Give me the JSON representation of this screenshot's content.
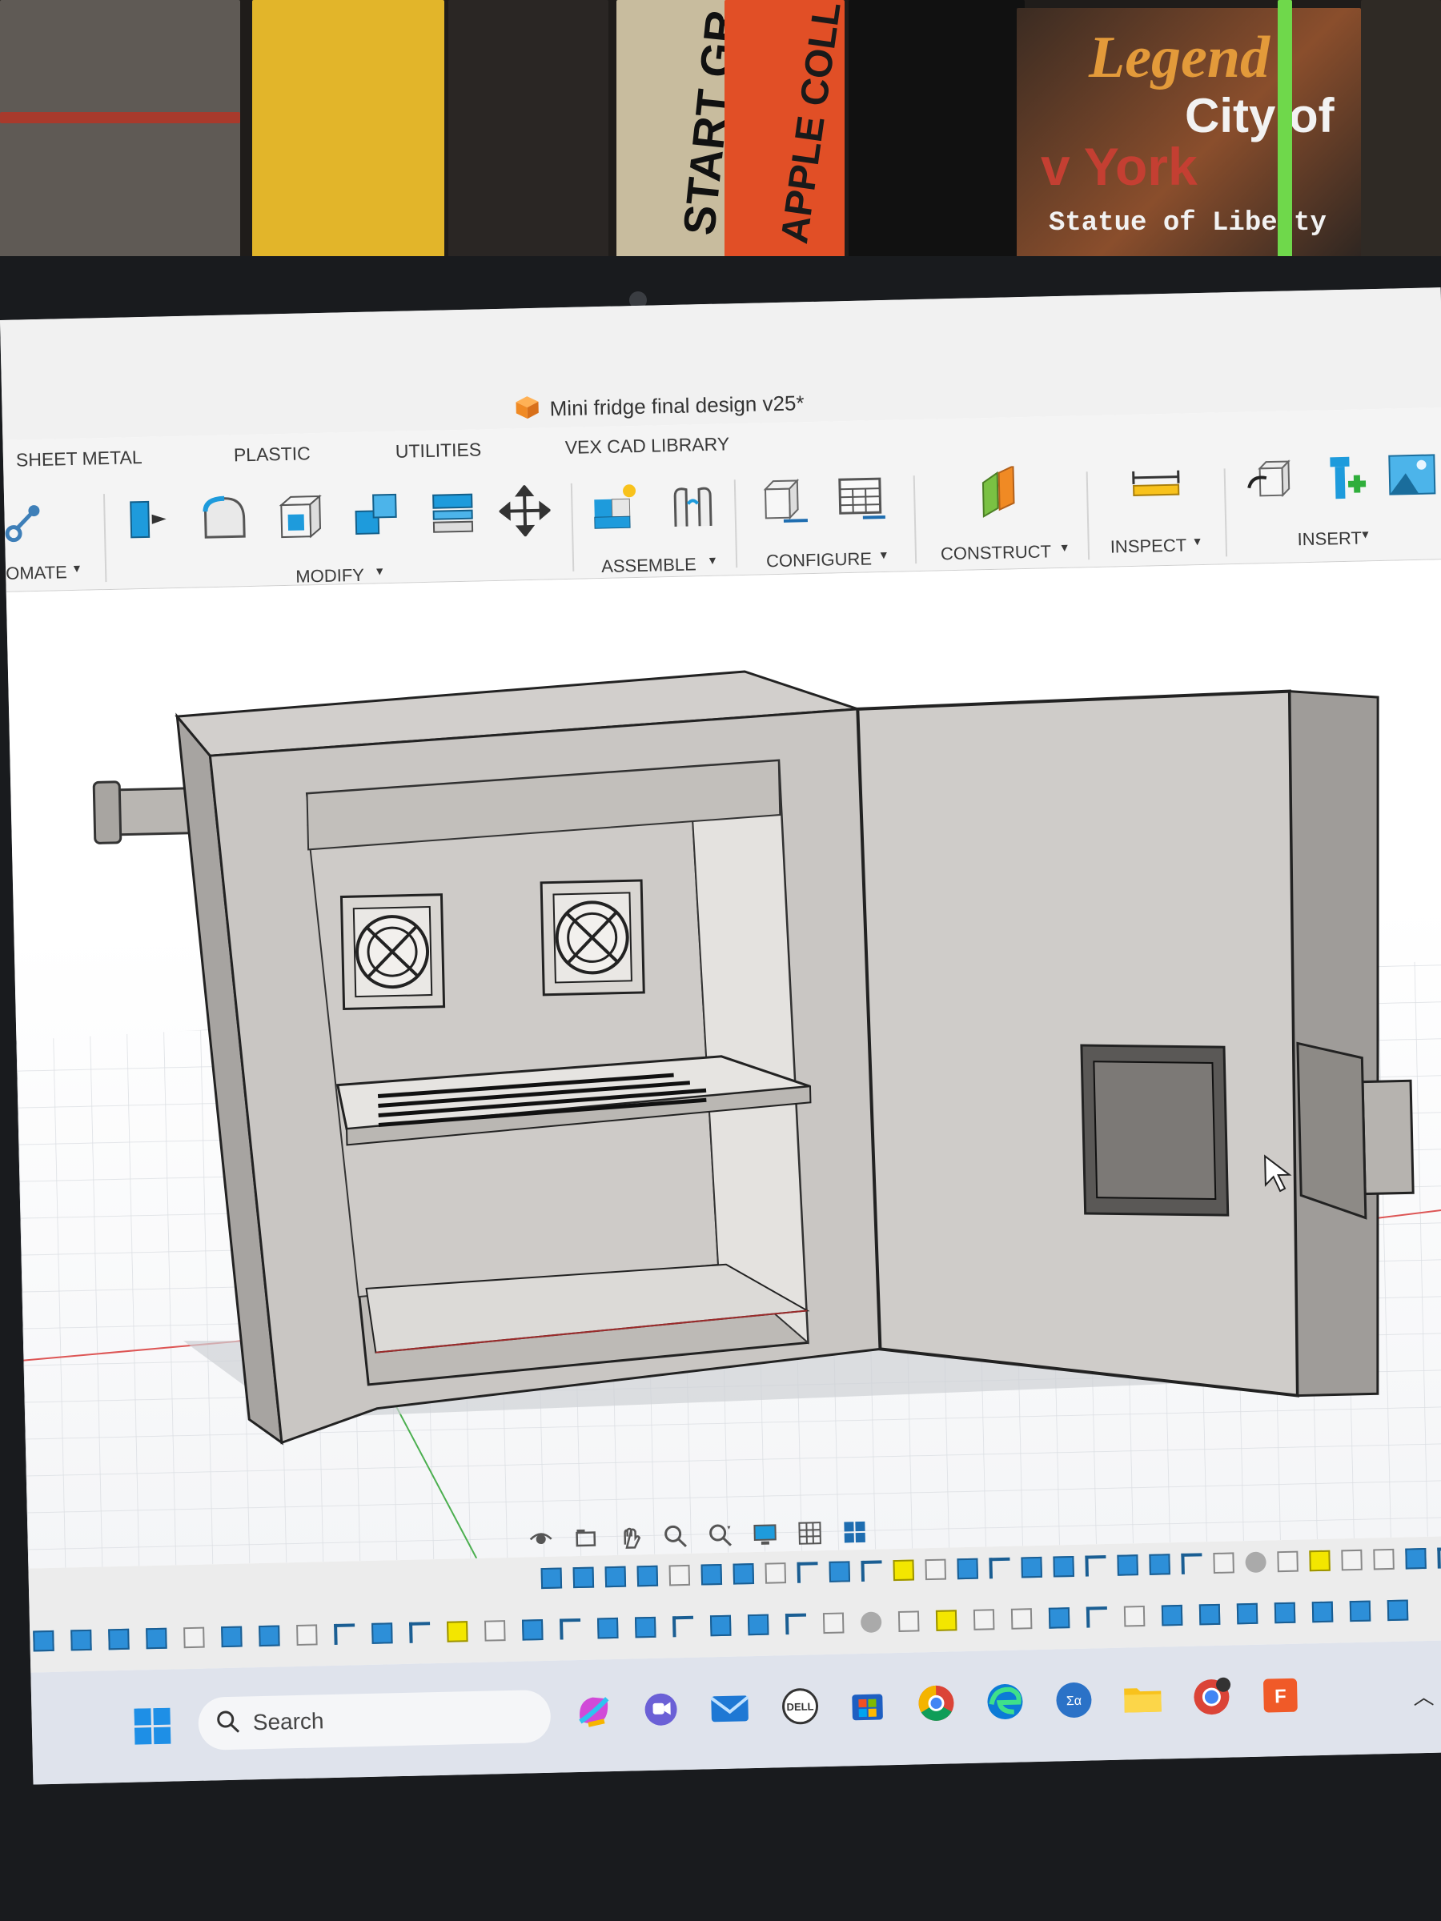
{
  "window": {
    "title": "Mini fridge final design v25*"
  },
  "toolbar": {
    "tabs": [
      "SHEET METAL",
      "PLASTIC",
      "UTILITIES",
      "VEX CAD LIBRARY"
    ],
    "groups": {
      "automate": "OMATE",
      "modify": "MODIFY",
      "assemble": "ASSEMBLE",
      "configure": "CONFIGURE",
      "construct": "CONSTRUCT",
      "inspect": "INSPECT",
      "insert": "INSERT"
    }
  },
  "taskbar": {
    "search_placeholder": "Search"
  },
  "books": {
    "spine_a": "START GR",
    "spine_b": "APPLE COLL",
    "cover_line1": "Legend",
    "cover_line2": "City of",
    "cover_line3": "v York",
    "cover_line4": "Statue of Liberty"
  },
  "colors": {
    "accent_blue": "#1e9bdc",
    "orange": "#f08a24",
    "model_gray": "#c9c6c3",
    "timeline_blue": "#2d8fd8",
    "timeline_yellow": "#f3e600"
  },
  "icons": {
    "app": "fusion-box-icon",
    "search": "magnifier-icon",
    "windows": "windows-logo-icon"
  }
}
